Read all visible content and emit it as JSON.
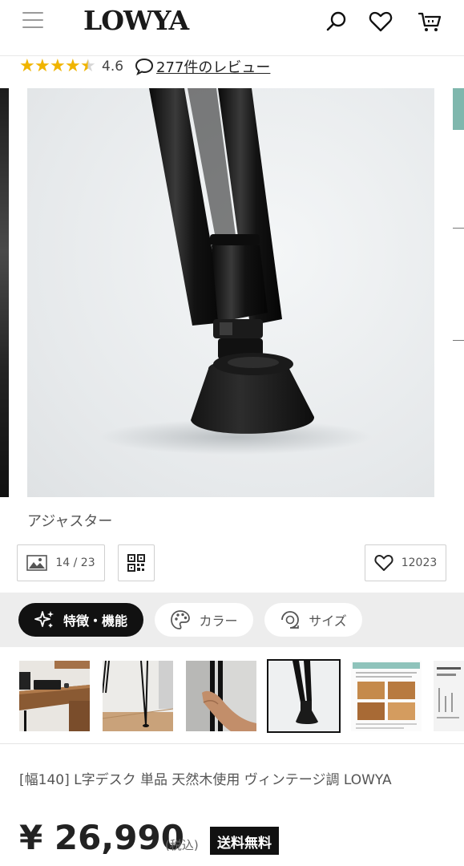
{
  "header": {
    "logo": "LOWYA"
  },
  "rating": {
    "value": "4.6",
    "reviews_label": "277件のレビュー",
    "stars": 4.5
  },
  "gallery": {
    "caption": "アジャスター",
    "counter": "14 / 23",
    "favorite_count": "12023"
  },
  "tabs": [
    {
      "label": "特徴・機能"
    },
    {
      "label": "カラー"
    },
    {
      "label": "サイズ"
    }
  ],
  "product": {
    "title": "[幅140] L字デスク 単品 天然木使用 ヴィンテージ調  LOWYA",
    "price": "¥ 26,990",
    "tax_label": "(税込)",
    "shipping_badge": "送料無料"
  },
  "colors": {
    "accent": "#111111",
    "star": "#f0b400",
    "tab_bg": "#ededed"
  }
}
